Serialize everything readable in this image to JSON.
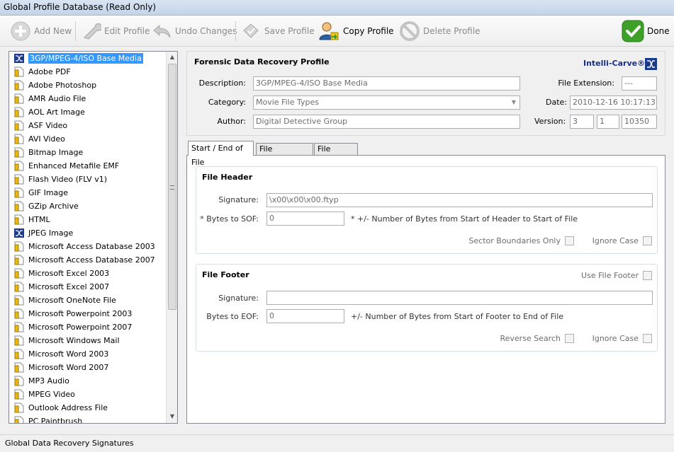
{
  "window": {
    "title": "Global Profile Database (Read Only)"
  },
  "toolbar": {
    "add_new": "Add New",
    "edit_profile": "Edit Profile",
    "undo_changes": "Undo Changes",
    "save_profile": "Save Profile",
    "copy_profile": "Copy Profile",
    "delete_profile": "Delete Profile",
    "done": "Done"
  },
  "tree": {
    "items": [
      "3GP/MPEG-4/ISO Base Media",
      "Adobe PDF",
      "Adobe Photoshop",
      "AMR Audio File",
      "AOL Art Image",
      "ASF Video",
      "AVI Video",
      "Bitmap Image",
      "Enhanced Metafile EMF",
      "Flash Video (FLV v1)",
      "GIF Image",
      "GZip Archive",
      "HTML",
      "JPEG Image",
      "Microsoft Access Database 2003",
      "Microsoft Access Database 2007",
      "Microsoft Excel 2003",
      "Microsoft Excel 2007",
      "Microsoft OneNote File",
      "Microsoft Powerpoint 2003",
      "Microsoft Powerpoint 2007",
      "Microsoft Windows Mail",
      "Microsoft Word 2003",
      "Microsoft Word 2007",
      "MP3 Audio",
      "MPEG Video",
      "Outlook Address File",
      "PC Paintbrush"
    ],
    "selected_index": 0
  },
  "profile": {
    "heading": "Forensic Data Recovery Profile",
    "brand": "Intelli-Carve®",
    "description_label": "Description:",
    "description_value": "3GP/MPEG-4/ISO Base Media",
    "category_label": "Category:",
    "category_value": "Movie File Types",
    "author_label": "Author:",
    "author_value": "Digital Detective Group",
    "file_extension_label": "File Extension:",
    "file_extension_value": "---",
    "date_label": "Date:",
    "date_value": "2010-12-16 10:17:13",
    "version_label": "Version:",
    "version_major": "3",
    "version_minor": "1",
    "version_build": "10350"
  },
  "tabs": [
    "Start / End of File",
    "File Landmarks",
    "File Length"
  ],
  "file_header": {
    "title": "File Header",
    "signature_label": "Signature:",
    "signature_value": "\\x00\\x00\\x00.ftyp",
    "bytes_label": "* Bytes to SOF:",
    "bytes_value": "0",
    "bytes_hint": "* +/- Number of Bytes from Start of Header to Start of File",
    "sector_label": "Sector Boundaries Only",
    "ignore_case_label": "Ignore Case"
  },
  "file_footer": {
    "title": "File Footer",
    "use_footer_label": "Use File Footer",
    "signature_label": "Signature:",
    "signature_value": "",
    "bytes_label": "Bytes to EOF:",
    "bytes_value": "0",
    "bytes_hint": "+/- Number of Bytes from Start of Footer to End of File",
    "reverse_label": "Reverse Search",
    "ignore_case_label": "Ignore Case"
  },
  "status": {
    "text": "Global Data Recovery Signatures"
  }
}
